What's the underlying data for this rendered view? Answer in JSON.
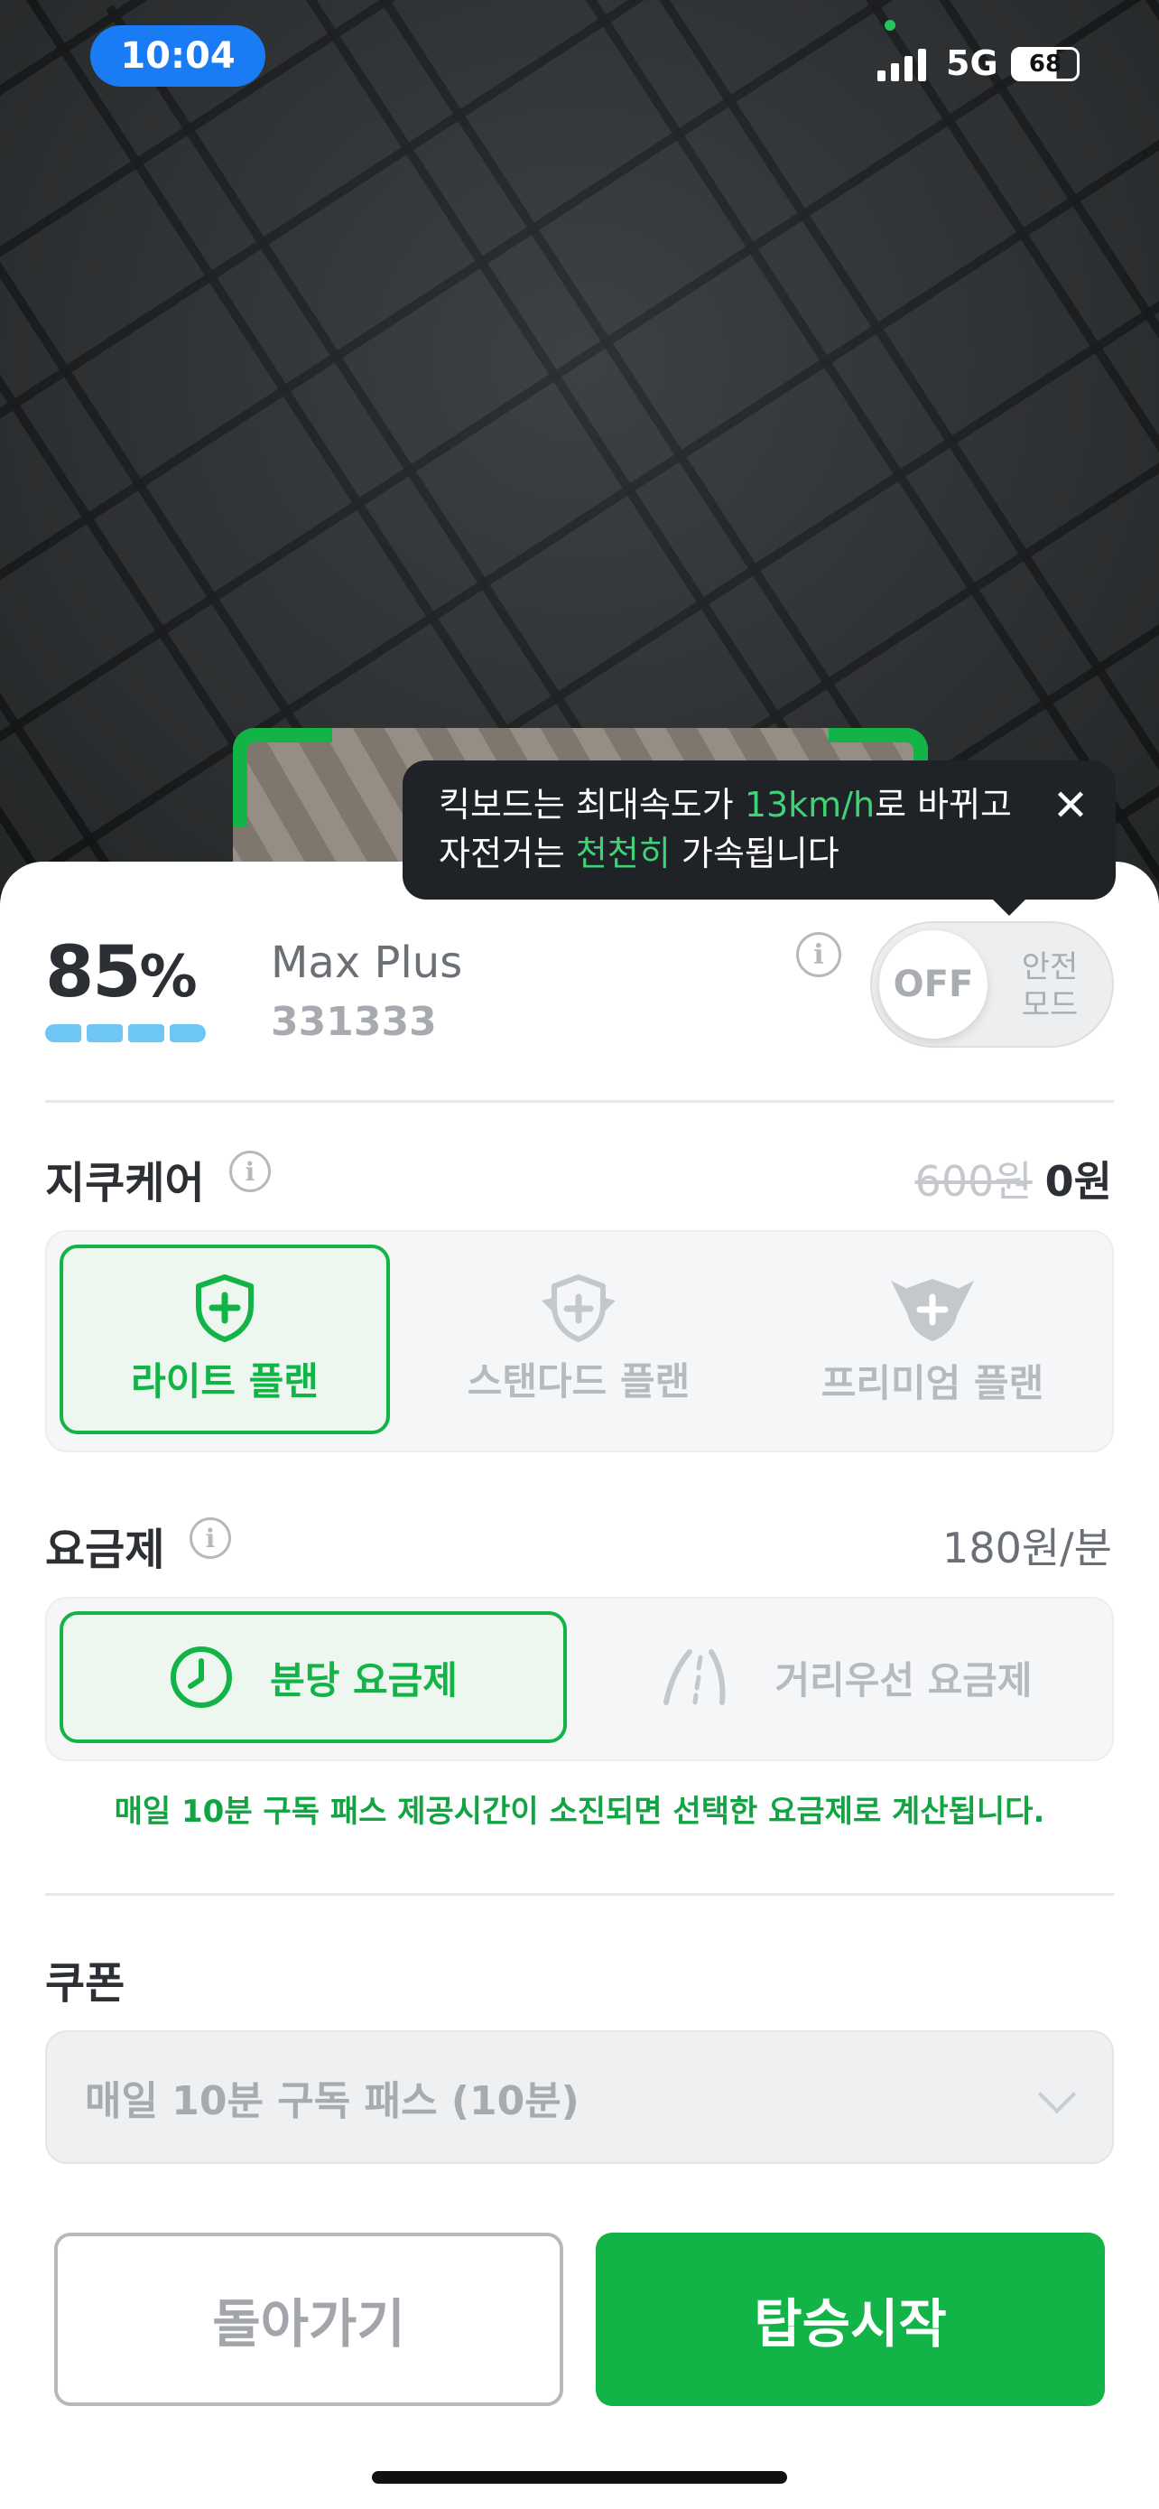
{
  "status_bar": {
    "time": "10:04",
    "network": "5G",
    "battery": "68"
  },
  "tooltip": {
    "line1_pre": "킥보드는 최대속도가 ",
    "line1_hl": "13km/h",
    "line1_post": "로 바뀌고",
    "line2_pre": "자전거는 ",
    "line2_hl": "천천히",
    "line2_post": " 가속됩니다",
    "close_glyph": "✕"
  },
  "vehicle": {
    "battery_number": "85",
    "battery_unit": "%",
    "battery_level": 0.85,
    "model": "Max Plus",
    "id": "331333"
  },
  "safety_mode": {
    "state": "OFF",
    "label_line1": "안전",
    "label_line2": "모드"
  },
  "care": {
    "title": "지쿠케어",
    "original_price": "600원",
    "price": "0원",
    "options": [
      {
        "label": "라이트 플랜",
        "icon": "shield-plus-icon",
        "selected": true
      },
      {
        "label": "스탠다드 플랜",
        "icon": "winged-shield-icon",
        "selected": false
      },
      {
        "label": "프리미엄 플랜",
        "icon": "crowned-shield-icon",
        "selected": false
      }
    ]
  },
  "fare": {
    "title": "요금제",
    "price": "180원/분",
    "options": [
      {
        "label": "분당 요금제",
        "icon": "clock-icon",
        "selected": true
      },
      {
        "label": "거리우선 요금제",
        "icon": "road-icon",
        "selected": false
      }
    ],
    "notice": "매일 10분 구독 패스 제공시간이 소진되면 선택한 요금제로 계산됩니다."
  },
  "coupon": {
    "title": "쿠폰",
    "selected": "매일 10분 구독 패스 (10분)"
  },
  "buttons": {
    "back": "돌아가기",
    "start": "탑승시작"
  },
  "colors": {
    "accent": "#12b347",
    "tooltip_bg": "#1f2226",
    "battery_bar": "#6ec6f5",
    "time_pill": "#1a7cf5"
  },
  "info_glyph": "i"
}
